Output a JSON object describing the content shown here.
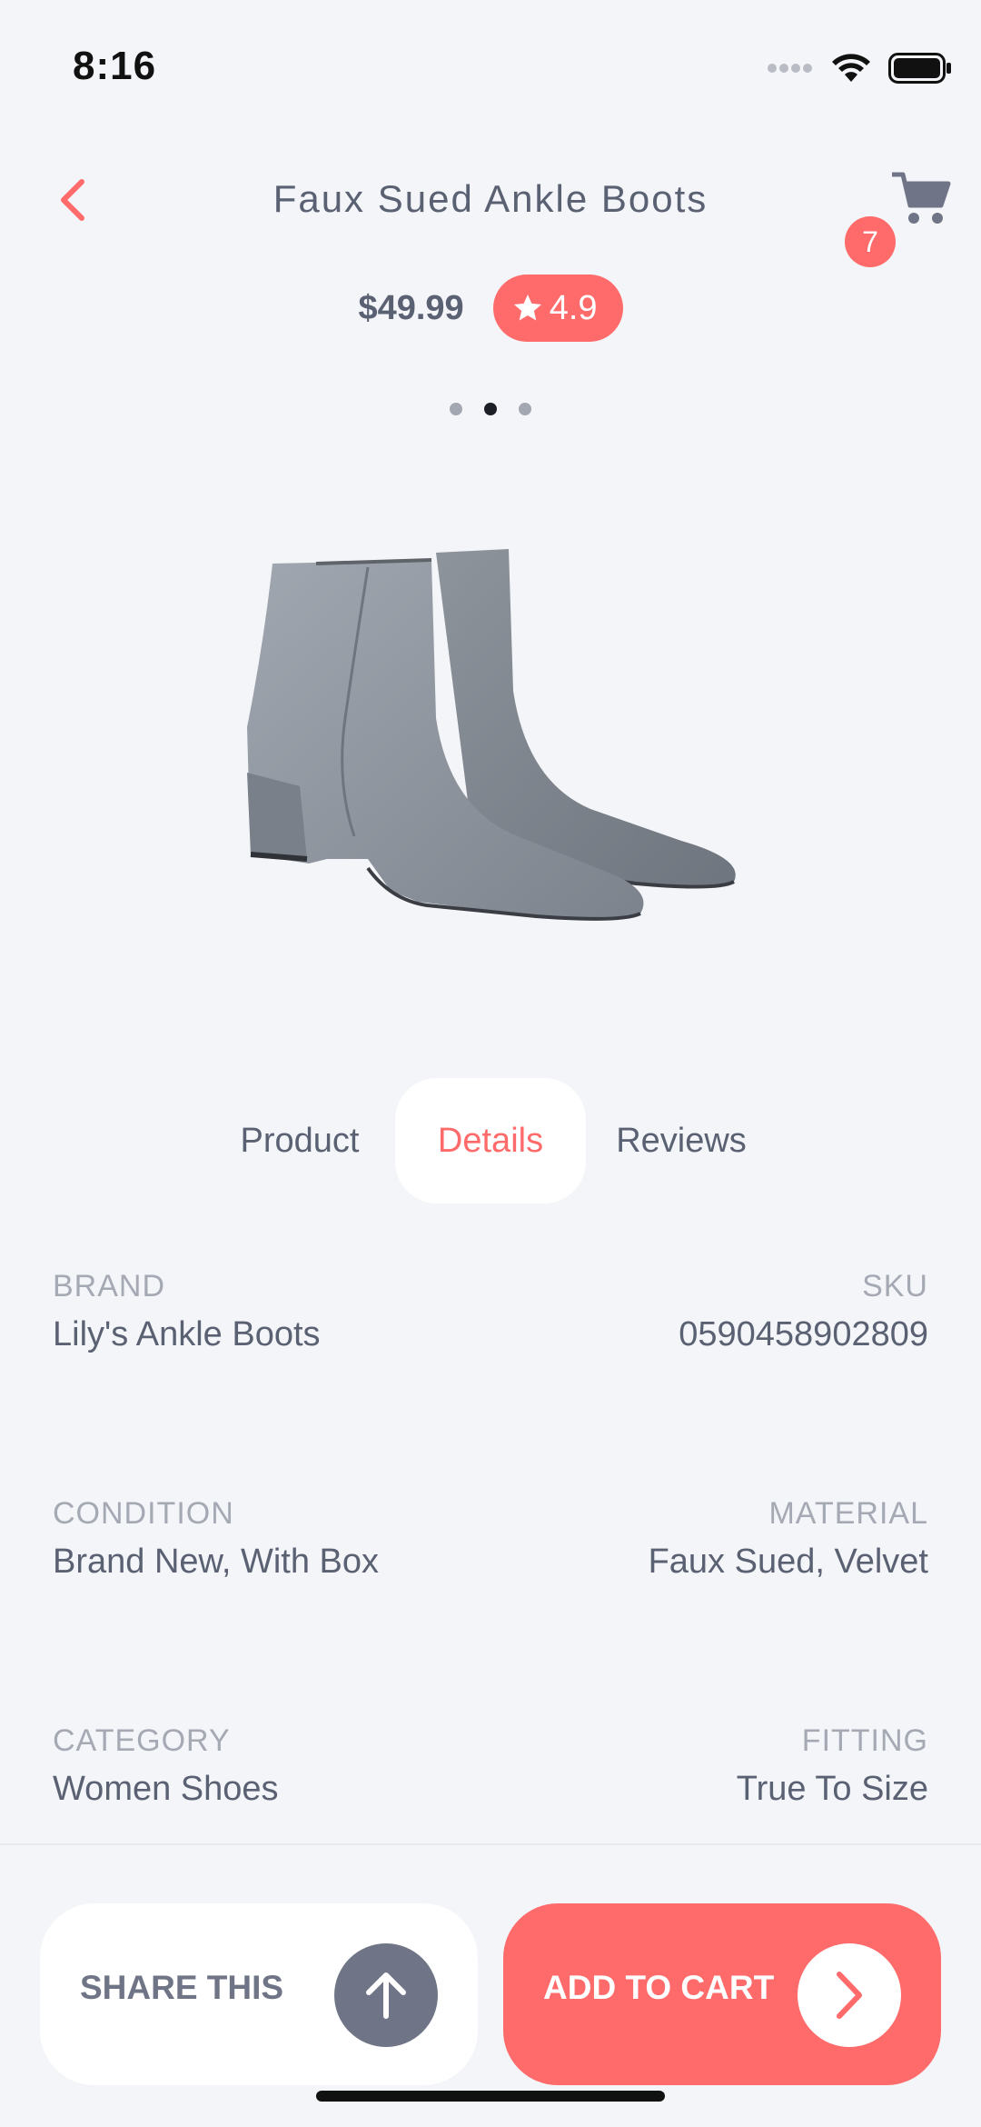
{
  "status_bar": {
    "time": "8:16"
  },
  "header": {
    "title": "Faux Sued Ankle Boots",
    "cart_count": "7",
    "price": "$49.99",
    "rating": "4.9"
  },
  "gallery": {
    "page_count": 3,
    "active_index": 1
  },
  "tabs": [
    {
      "label": "Product"
    },
    {
      "label": "Details"
    },
    {
      "label": "Reviews"
    }
  ],
  "details": {
    "brand_label": "BRAND",
    "brand_value": "Lily's Ankle Boots",
    "sku_label": "SKU",
    "sku_value": "0590458902809",
    "condition_label": "CONDITION",
    "condition_value": "Brand New, With Box",
    "material_label": "MATERIAL",
    "material_value": "Faux Sued, Velvet",
    "category_label": "CATEGORY",
    "category_value": "Women Shoes",
    "fitting_label": "FITTING",
    "fitting_value": "True To Size"
  },
  "actions": {
    "share_label": "SHARE THIS",
    "cart_label": "ADD TO CART"
  },
  "icons": {
    "back": "chevron-left-icon",
    "cart": "shopping-cart-icon",
    "star": "star-icon",
    "share": "arrow-up-icon",
    "add": "chevron-right-icon"
  },
  "colors": {
    "accent": "#ff6b6b",
    "text": "#5a6173",
    "muted": "#a5a9b4",
    "background": "#f4f5f8"
  }
}
